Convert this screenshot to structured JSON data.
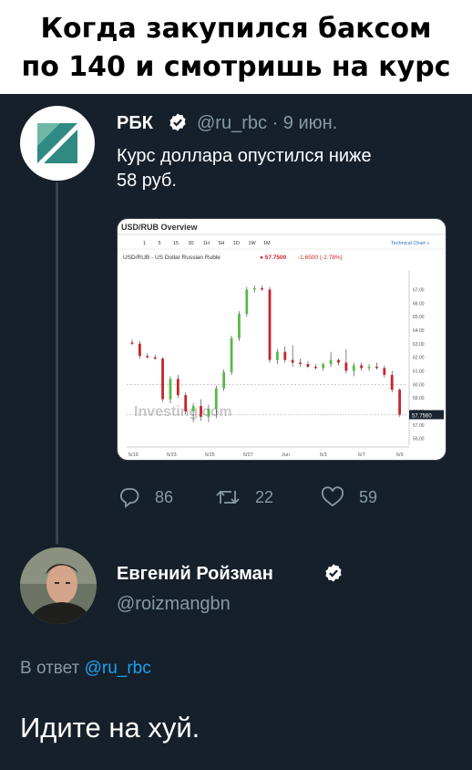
{
  "caption": {
    "line1": "Когда закупился баксом",
    "line2": "по 140 и смотришь на курс"
  },
  "tweet": {
    "author_name": "РБК",
    "handle": "@ru_rbc",
    "separator": "·",
    "date": "9 июн.",
    "text_line1": "Курс доллара опустился ниже",
    "text_line2": "58 руб.",
    "replies": "86",
    "retweets": "22",
    "likes": "59"
  },
  "chart_image": {
    "title": "USD/RUB Overview",
    "timeframes": [
      "1",
      "5",
      "15",
      "30",
      "1H",
      "5H",
      "1D",
      "1W",
      "1M"
    ],
    "technical_chart": "Technical Chart »",
    "instrument": "USD/RUB - US Dollar Russian Ruble",
    "price": "57.7500",
    "change": "-1.6500 (-2.78%)",
    "watermark": "Investing.com",
    "current_label": "57.7560"
  },
  "chart_data": {
    "type": "candlestick",
    "title": "USD/RUB Overview",
    "x_labels": [
      "5/19",
      "5/23",
      "5/25",
      "5/27",
      "Jun",
      "6/3",
      "6/7",
      "6/9"
    ],
    "y_ticks": [
      "67.00",
      "66.00",
      "65.00",
      "64.00",
      "63.00",
      "62.00",
      "61.00",
      "60.00",
      "59.00",
      "58.00",
      "57.00",
      "56.00"
    ],
    "ylim": [
      55.5,
      67.5
    ],
    "current_price": 57.756,
    "candles": [
      {
        "o": 63.1,
        "h": 63.3,
        "l": 62.9,
        "c": 63.0
      },
      {
        "o": 63.0,
        "h": 63.2,
        "l": 61.9,
        "c": 62.1
      },
      {
        "o": 62.1,
        "h": 62.3,
        "l": 61.9,
        "c": 62.0
      },
      {
        "o": 62.0,
        "h": 62.2,
        "l": 61.8,
        "c": 61.9
      },
      {
        "o": 61.9,
        "h": 62.0,
        "l": 58.7,
        "c": 58.9
      },
      {
        "o": 58.9,
        "h": 60.6,
        "l": 58.6,
        "c": 60.4
      },
      {
        "o": 60.4,
        "h": 60.7,
        "l": 59.0,
        "c": 59.2
      },
      {
        "o": 59.2,
        "h": 59.4,
        "l": 57.8,
        "c": 58.0
      },
      {
        "o": 58.0,
        "h": 58.6,
        "l": 57.2,
        "c": 58.4
      },
      {
        "o": 58.4,
        "h": 58.9,
        "l": 57.3,
        "c": 57.6
      },
      {
        "o": 57.6,
        "h": 58.5,
        "l": 57.2,
        "c": 58.2
      },
      {
        "o": 58.2,
        "h": 59.9,
        "l": 57.5,
        "c": 59.7
      },
      {
        "o": 59.7,
        "h": 61.1,
        "l": 59.5,
        "c": 60.9
      },
      {
        "o": 60.9,
        "h": 63.6,
        "l": 60.7,
        "c": 63.4
      },
      {
        "o": 63.4,
        "h": 65.4,
        "l": 63.2,
        "c": 65.2
      },
      {
        "o": 65.2,
        "h": 67.2,
        "l": 65.0,
        "c": 67.0
      },
      {
        "o": 67.0,
        "h": 67.3,
        "l": 66.8,
        "c": 67.1
      },
      {
        "o": 67.1,
        "h": 67.3,
        "l": 66.9,
        "c": 67.0
      },
      {
        "o": 67.0,
        "h": 67.2,
        "l": 61.6,
        "c": 61.8
      },
      {
        "o": 61.8,
        "h": 62.6,
        "l": 61.5,
        "c": 62.4
      },
      {
        "o": 62.4,
        "h": 62.8,
        "l": 61.6,
        "c": 61.8
      },
      {
        "o": 61.8,
        "h": 62.9,
        "l": 61.3,
        "c": 61.6
      },
      {
        "o": 61.6,
        "h": 61.9,
        "l": 61.3,
        "c": 61.5
      },
      {
        "o": 61.5,
        "h": 61.7,
        "l": 61.2,
        "c": 61.3
      },
      {
        "o": 61.3,
        "h": 61.5,
        "l": 61.1,
        "c": 61.2
      },
      {
        "o": 61.2,
        "h": 61.6,
        "l": 61.0,
        "c": 61.5
      },
      {
        "o": 61.5,
        "h": 62.4,
        "l": 61.3,
        "c": 61.8
      },
      {
        "o": 61.8,
        "h": 61.9,
        "l": 61.4,
        "c": 61.6
      },
      {
        "o": 61.6,
        "h": 62.6,
        "l": 60.8,
        "c": 61.0
      },
      {
        "o": 61.0,
        "h": 61.6,
        "l": 60.6,
        "c": 61.4
      },
      {
        "o": 61.4,
        "h": 61.6,
        "l": 61.0,
        "c": 61.2
      },
      {
        "o": 61.2,
        "h": 61.5,
        "l": 61.0,
        "c": 61.3
      },
      {
        "o": 61.3,
        "h": 61.6,
        "l": 61.1,
        "c": 61.2
      },
      {
        "o": 61.2,
        "h": 61.4,
        "l": 60.5,
        "c": 60.7
      },
      {
        "o": 60.7,
        "h": 61.0,
        "l": 59.4,
        "c": 59.6
      },
      {
        "o": 59.6,
        "h": 59.7,
        "l": 57.6,
        "c": 57.76
      }
    ]
  },
  "reply": {
    "author_name": "Евгений Ройзман",
    "handle": "@roizmangbn",
    "reply_prefix": "В ответ",
    "reply_to": "@ru_rbc",
    "text": "Идите на хуй."
  },
  "colors": {
    "background": "#15202b",
    "secondary_text": "#8899a6",
    "link": "#1da1f2",
    "thread_line": "#38444d",
    "bull": "#58b947",
    "bear": "#c8242a"
  }
}
